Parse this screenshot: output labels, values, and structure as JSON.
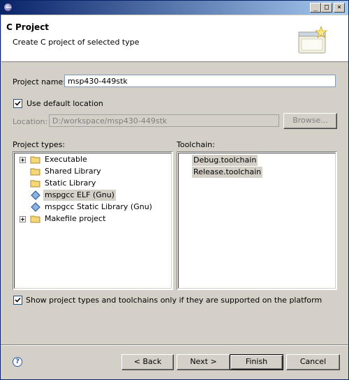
{
  "window": {
    "title_bar": {
      "minimize_glyph": "_",
      "maximize_glyph": "□",
      "close_glyph": "×"
    }
  },
  "header": {
    "title": "C Project",
    "subtitle": "Create C project of selected type"
  },
  "form": {
    "project_name_label": "Project name:",
    "project_name_value": "msp430-449stk",
    "use_default_location_label": "Use default location",
    "use_default_location_checked": true,
    "location_label": "Location:",
    "location_value": "D:/workspace/msp430-449stk",
    "browse_label": "Browse..."
  },
  "project_types": {
    "label": "Project types:",
    "items": [
      {
        "label": "Executable",
        "icon": "folder-icon",
        "expandable": true,
        "selected": false
      },
      {
        "label": "Shared Library",
        "icon": "folder-icon",
        "expandable": false,
        "selected": false
      },
      {
        "label": "Static Library",
        "icon": "folder-icon",
        "expandable": false,
        "selected": false
      },
      {
        "label": "mspgcc ELF (Gnu)",
        "icon": "diamond-icon",
        "expandable": false,
        "selected": true
      },
      {
        "label": "mspgcc Static Library (Gnu)",
        "icon": "diamond-icon",
        "expandable": false,
        "selected": false
      },
      {
        "label": "Makefile project",
        "icon": "folder-icon",
        "expandable": true,
        "selected": false
      }
    ]
  },
  "toolchain": {
    "label": "Toolchain:",
    "items": [
      "Debug.toolchain",
      "Release.toolchain"
    ]
  },
  "filter": {
    "label": "Show project types and toolchains only if they are supported on the platform",
    "checked": true
  },
  "buttons": {
    "back": "< Back",
    "next": "Next >",
    "finish": "Finish",
    "cancel": "Cancel"
  },
  "colors": {
    "title_bar_start": "#0a246a",
    "title_bar_end": "#a6caf0",
    "dialog_bg": "#d4d0c8",
    "selection_bg": "#d4d0c8"
  }
}
